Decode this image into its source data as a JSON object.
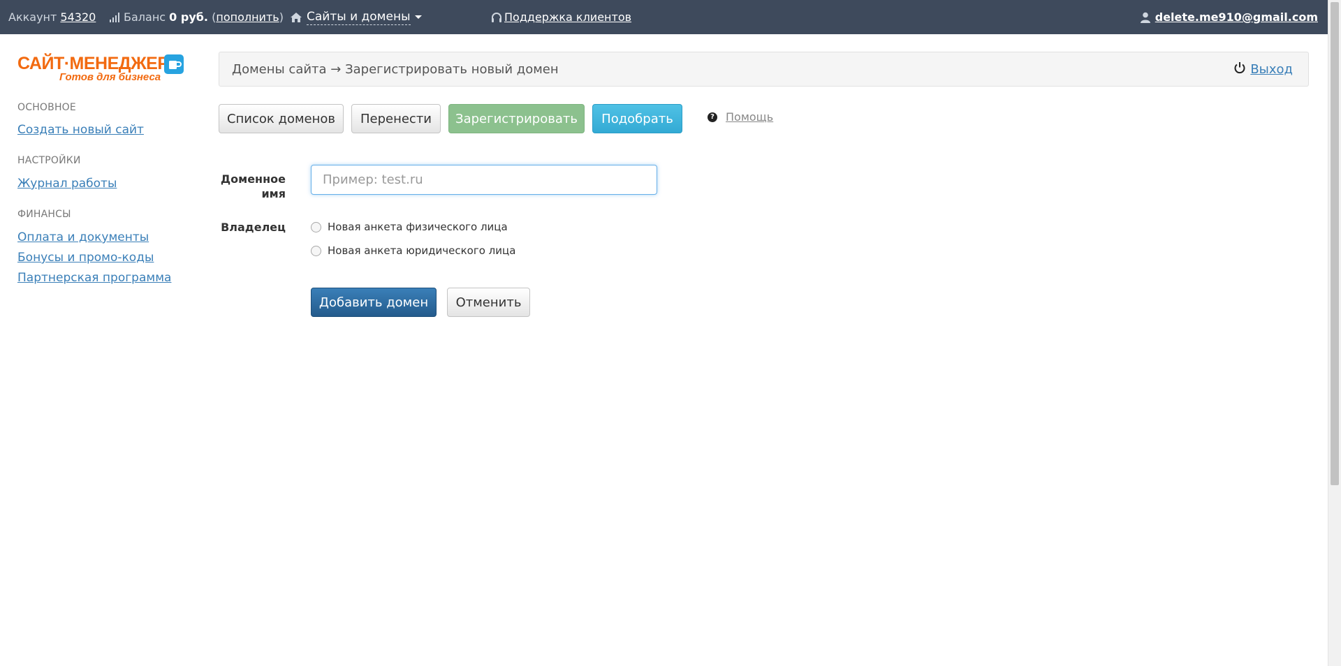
{
  "topbar": {
    "account_label": "Аккаунт",
    "account_number": "54320",
    "balance_label": "Баланс",
    "balance_value": "0 руб.",
    "topup_paren_open": "(",
    "topup_link": "пополнить",
    "topup_paren_close": ")",
    "sites_menu": "Сайты и домены",
    "support_link": "Поддержка клиентов",
    "user_email": "delete.me910@gmail.com"
  },
  "logo": {
    "title": "САЙТ·МЕНЕДЖЕР",
    "subtitle": "Готов для бизнеса"
  },
  "sidebar": {
    "sections": [
      {
        "heading": "ОСНОВНОЕ",
        "links": [
          "Создать новый сайт"
        ]
      },
      {
        "heading": "НАСТРОЙКИ",
        "links": [
          "Журнал работы"
        ]
      },
      {
        "heading": "ФИНАНСЫ",
        "links": [
          "Оплата и документы",
          "Бонусы и промо-коды",
          "Партнерская программа"
        ]
      }
    ]
  },
  "breadcrumb": {
    "text": "Домены сайта → Зарегистрировать новый домен",
    "logout": "Выход"
  },
  "tabs": {
    "list": "Список доменов",
    "transfer": "Перенести",
    "register": "Зарегистрировать",
    "pick": "Подобрать",
    "help": "Помощь"
  },
  "form": {
    "domain_label_line1": "Доменное",
    "domain_label_line2": "имя",
    "domain_placeholder": "Пример: test.ru",
    "domain_value": "",
    "owner_label": "Владелец",
    "owner_options": [
      "Новая анкета физического лица",
      "Новая анкета юридического лица"
    ],
    "submit": "Добавить домен",
    "cancel": "Отменить"
  },
  "colors": {
    "topbar_bg": "#3e4a5c",
    "brand_orange": "#f26a10",
    "link_blue": "#3a7fb8",
    "register_green": "#8cc18e",
    "pick_blue": "#33aad4",
    "primary_blue": "#245b8c"
  }
}
